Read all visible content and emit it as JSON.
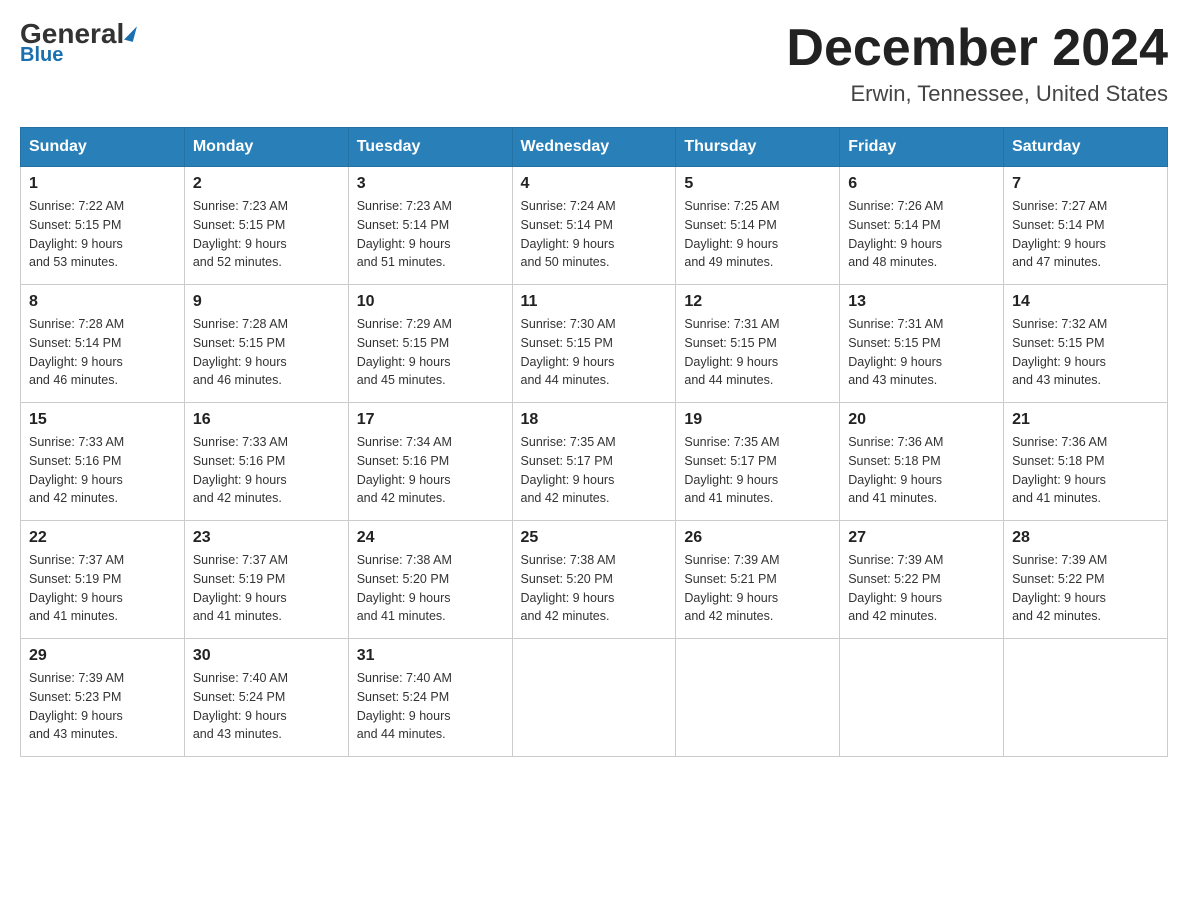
{
  "header": {
    "logo_name": "General",
    "logo_sub": "Blue",
    "month_title": "December 2024",
    "location": "Erwin, Tennessee, United States"
  },
  "days_of_week": [
    "Sunday",
    "Monday",
    "Tuesday",
    "Wednesday",
    "Thursday",
    "Friday",
    "Saturday"
  ],
  "weeks": [
    [
      {
        "day": "1",
        "sunrise": "7:22 AM",
        "sunset": "5:15 PM",
        "daylight": "9 hours and 53 minutes."
      },
      {
        "day": "2",
        "sunrise": "7:23 AM",
        "sunset": "5:15 PM",
        "daylight": "9 hours and 52 minutes."
      },
      {
        "day": "3",
        "sunrise": "7:23 AM",
        "sunset": "5:14 PM",
        "daylight": "9 hours and 51 minutes."
      },
      {
        "day": "4",
        "sunrise": "7:24 AM",
        "sunset": "5:14 PM",
        "daylight": "9 hours and 50 minutes."
      },
      {
        "day": "5",
        "sunrise": "7:25 AM",
        "sunset": "5:14 PM",
        "daylight": "9 hours and 49 minutes."
      },
      {
        "day": "6",
        "sunrise": "7:26 AM",
        "sunset": "5:14 PM",
        "daylight": "9 hours and 48 minutes."
      },
      {
        "day": "7",
        "sunrise": "7:27 AM",
        "sunset": "5:14 PM",
        "daylight": "9 hours and 47 minutes."
      }
    ],
    [
      {
        "day": "8",
        "sunrise": "7:28 AM",
        "sunset": "5:14 PM",
        "daylight": "9 hours and 46 minutes."
      },
      {
        "day": "9",
        "sunrise": "7:28 AM",
        "sunset": "5:15 PM",
        "daylight": "9 hours and 46 minutes."
      },
      {
        "day": "10",
        "sunrise": "7:29 AM",
        "sunset": "5:15 PM",
        "daylight": "9 hours and 45 minutes."
      },
      {
        "day": "11",
        "sunrise": "7:30 AM",
        "sunset": "5:15 PM",
        "daylight": "9 hours and 44 minutes."
      },
      {
        "day": "12",
        "sunrise": "7:31 AM",
        "sunset": "5:15 PM",
        "daylight": "9 hours and 44 minutes."
      },
      {
        "day": "13",
        "sunrise": "7:31 AM",
        "sunset": "5:15 PM",
        "daylight": "9 hours and 43 minutes."
      },
      {
        "day": "14",
        "sunrise": "7:32 AM",
        "sunset": "5:15 PM",
        "daylight": "9 hours and 43 minutes."
      }
    ],
    [
      {
        "day": "15",
        "sunrise": "7:33 AM",
        "sunset": "5:16 PM",
        "daylight": "9 hours and 42 minutes."
      },
      {
        "day": "16",
        "sunrise": "7:33 AM",
        "sunset": "5:16 PM",
        "daylight": "9 hours and 42 minutes."
      },
      {
        "day": "17",
        "sunrise": "7:34 AM",
        "sunset": "5:16 PM",
        "daylight": "9 hours and 42 minutes."
      },
      {
        "day": "18",
        "sunrise": "7:35 AM",
        "sunset": "5:17 PM",
        "daylight": "9 hours and 42 minutes."
      },
      {
        "day": "19",
        "sunrise": "7:35 AM",
        "sunset": "5:17 PM",
        "daylight": "9 hours and 41 minutes."
      },
      {
        "day": "20",
        "sunrise": "7:36 AM",
        "sunset": "5:18 PM",
        "daylight": "9 hours and 41 minutes."
      },
      {
        "day": "21",
        "sunrise": "7:36 AM",
        "sunset": "5:18 PM",
        "daylight": "9 hours and 41 minutes."
      }
    ],
    [
      {
        "day": "22",
        "sunrise": "7:37 AM",
        "sunset": "5:19 PM",
        "daylight": "9 hours and 41 minutes."
      },
      {
        "day": "23",
        "sunrise": "7:37 AM",
        "sunset": "5:19 PM",
        "daylight": "9 hours and 41 minutes."
      },
      {
        "day": "24",
        "sunrise": "7:38 AM",
        "sunset": "5:20 PM",
        "daylight": "9 hours and 41 minutes."
      },
      {
        "day": "25",
        "sunrise": "7:38 AM",
        "sunset": "5:20 PM",
        "daylight": "9 hours and 42 minutes."
      },
      {
        "day": "26",
        "sunrise": "7:39 AM",
        "sunset": "5:21 PM",
        "daylight": "9 hours and 42 minutes."
      },
      {
        "day": "27",
        "sunrise": "7:39 AM",
        "sunset": "5:22 PM",
        "daylight": "9 hours and 42 minutes."
      },
      {
        "day": "28",
        "sunrise": "7:39 AM",
        "sunset": "5:22 PM",
        "daylight": "9 hours and 42 minutes."
      }
    ],
    [
      {
        "day": "29",
        "sunrise": "7:39 AM",
        "sunset": "5:23 PM",
        "daylight": "9 hours and 43 minutes."
      },
      {
        "day": "30",
        "sunrise": "7:40 AM",
        "sunset": "5:24 PM",
        "daylight": "9 hours and 43 minutes."
      },
      {
        "day": "31",
        "sunrise": "7:40 AM",
        "sunset": "5:24 PM",
        "daylight": "9 hours and 44 minutes."
      },
      null,
      null,
      null,
      null
    ]
  ],
  "labels": {
    "sunrise": "Sunrise:",
    "sunset": "Sunset:",
    "daylight": "Daylight:"
  }
}
